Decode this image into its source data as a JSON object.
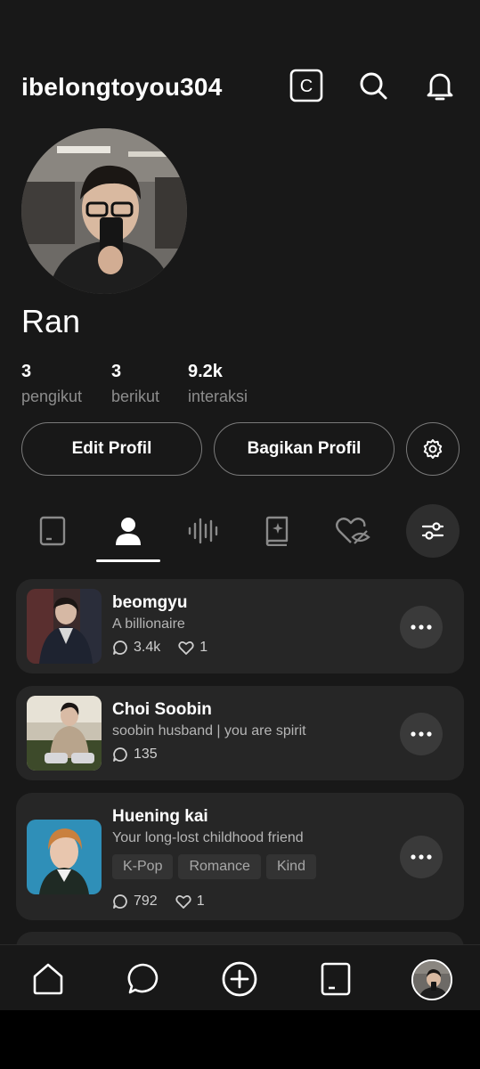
{
  "header": {
    "username": "ibelongtoyou304",
    "icons": [
      "c-square-icon",
      "search-icon",
      "bell-icon"
    ],
    "c_label": "C"
  },
  "profile": {
    "display_name": "Ran",
    "stats": [
      {
        "value": "3",
        "label": "pengikut"
      },
      {
        "value": "3",
        "label": "berikut"
      },
      {
        "value": "9.2k",
        "label": "interaksi"
      }
    ],
    "edit_label": "Edit Profil",
    "share_label": "Bagikan Profil"
  },
  "tabs": [
    {
      "icon": "tablet-icon",
      "active": false
    },
    {
      "icon": "person-icon",
      "active": true
    },
    {
      "icon": "audio-wave-icon",
      "active": false
    },
    {
      "icon": "sparkle-book-icon",
      "active": false
    },
    {
      "icon": "heart-hidden-icon",
      "active": false
    }
  ],
  "characters": [
    {
      "name": "beomgyu",
      "desc": "A billionaire",
      "comments": "3.4k",
      "likes": "1",
      "tags": []
    },
    {
      "name": "Choi Soobin",
      "desc": "soobin husband | you are spirit",
      "comments": "135",
      "likes": "",
      "tags": []
    },
    {
      "name": "Huening kai",
      "desc": "Your long-lost childhood friend",
      "comments": "792",
      "likes": "1",
      "tags": [
        "K-Pop",
        "Romance",
        "Kind"
      ]
    }
  ],
  "bottom_nav": [
    "home-icon",
    "chat-icon",
    "add-icon",
    "tablet-icon",
    "profile-avatar"
  ],
  "colors": {
    "background": "#181818",
    "card": "#262626",
    "muted_text": "#8d8d8d",
    "accent": "#ffffff"
  }
}
